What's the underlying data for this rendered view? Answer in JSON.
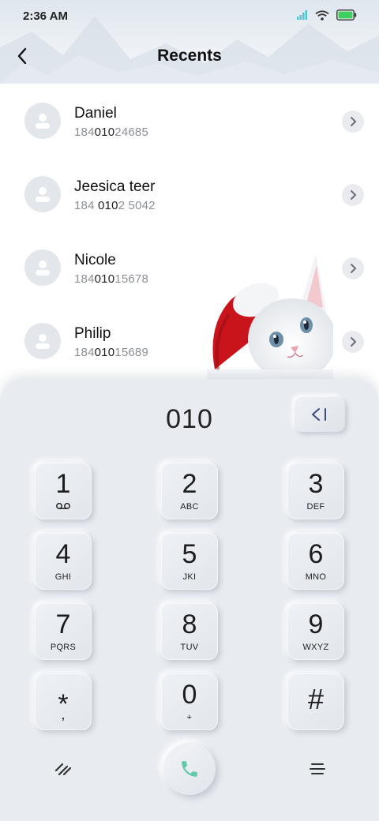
{
  "status_bar": {
    "time": "2:36 AM"
  },
  "header": {
    "title": "Recents"
  },
  "recents": [
    {
      "name": "Daniel",
      "number_parts": [
        "184",
        "010",
        "24685"
      ]
    },
    {
      "name": "Jeesica teer",
      "number_parts": [
        "184 ",
        "010",
        "2 5042"
      ]
    },
    {
      "name": "Nicole",
      "number_parts": [
        "184",
        "010",
        "15678"
      ]
    },
    {
      "name": "Philip",
      "number_parts": [
        "184",
        "010",
        "15689"
      ]
    }
  ],
  "dialpad": {
    "entered": "010",
    "keys": [
      {
        "digit": "1",
        "letters": ""
      },
      {
        "digit": "2",
        "letters": "ABC"
      },
      {
        "digit": "3",
        "letters": "DEF"
      },
      {
        "digit": "4",
        "letters": "GHI"
      },
      {
        "digit": "5",
        "letters": "JKI"
      },
      {
        "digit": "6",
        "letters": "MNO"
      },
      {
        "digit": "7",
        "letters": "PQRS"
      },
      {
        "digit": "8",
        "letters": "TUV"
      },
      {
        "digit": "9",
        "letters": "WXYZ"
      },
      {
        "digit": "*",
        "letters": ","
      },
      {
        "digit": "0",
        "letters": "+"
      },
      {
        "digit": "#",
        "letters": ""
      }
    ]
  },
  "icons": {
    "back": "chevron-left-icon",
    "contact": "person-icon",
    "row_action": "chevron-right-icon",
    "backspace": "backspace-icon",
    "voicemail": "voicemail-icon",
    "collapse": "double-slash-icon",
    "call": "phone-icon",
    "menu": "menu-lines-icon"
  },
  "colors": {
    "call_icon": "#5fc9a8",
    "battery": "#3ecf5c",
    "signal": "#4fc6d2"
  }
}
